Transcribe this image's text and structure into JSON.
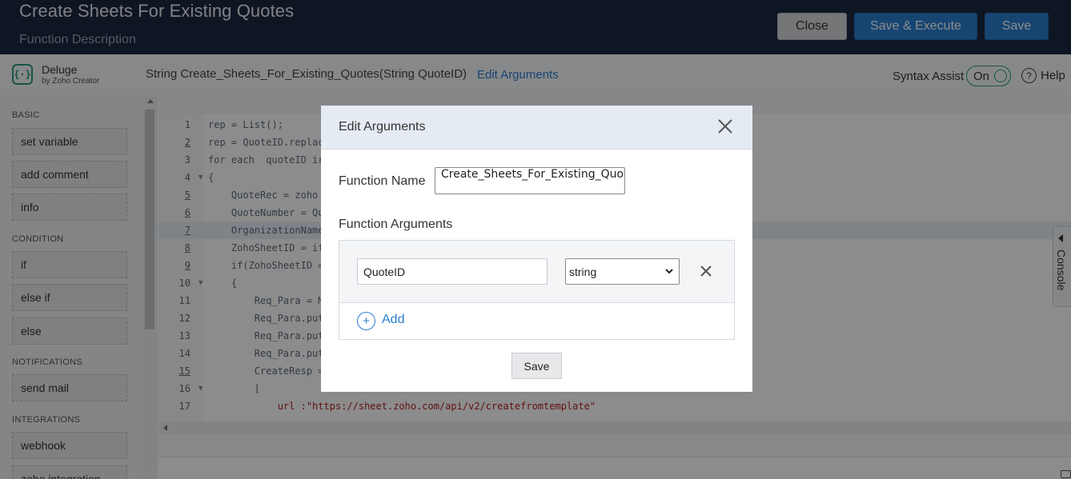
{
  "header": {
    "title": "Create Sheets For Existing Quotes",
    "description": "Function Description",
    "close_label": "Close",
    "save_execute_label": "Save & Execute",
    "save_label": "Save"
  },
  "toolbar": {
    "logo_glyph": "{·}",
    "product_name": "Deluge",
    "product_sub": "by Zoho Creator",
    "signature": "String  Create_Sheets_For_Existing_Quotes(String QuoteID)",
    "edit_arguments": "Edit Arguments",
    "syntax_assist_label": "Syntax Assist",
    "syntax_assist_state": "On",
    "help_glyph": "?",
    "help_label": "Help"
  },
  "sidebar": {
    "sections": [
      {
        "label": "BASIC",
        "items": [
          "set variable",
          "add comment",
          "info"
        ]
      },
      {
        "label": "CONDITION",
        "items": [
          "if",
          "else if",
          "else"
        ]
      },
      {
        "label": "NOTIFICATIONS",
        "items": [
          "send mail"
        ]
      },
      {
        "label": "INTEGRATIONS",
        "items": [
          "webhook",
          "zoho integration"
        ]
      }
    ]
  },
  "editor": {
    "lines": [
      {
        "n": "1",
        "text": "rep = List();"
      },
      {
        "n": "2",
        "text": "rep = QuoteID.replac"
      },
      {
        "n": "3",
        "text": "for each  quoteID ir"
      },
      {
        "n": "4",
        "text": "{"
      },
      {
        "n": "5",
        "text": "    QuoteRec = zoho"
      },
      {
        "n": "6",
        "text": "    QuoteNumber = Qu"
      },
      {
        "n": "7",
        "text": "    OrganizationName"
      },
      {
        "n": "8",
        "text": "    ZohoSheetID = if"
      },
      {
        "n": "9",
        "text": "    if(ZohoSheetID ="
      },
      {
        "n": "10",
        "text": "    {"
      },
      {
        "n": "11",
        "text": "        Req_Para = M"
      },
      {
        "n": "12",
        "text": "        Req_Para.put"
      },
      {
        "n": "13",
        "text": "        Req_Para.put"
      },
      {
        "n": "14",
        "text": "        Req_Para.put"
      },
      {
        "n": "15",
        "text": "        CreateResp ="
      },
      {
        "n": "16",
        "text": "        ["
      },
      {
        "n": "17",
        "text": "            url :\"https://sheet.zoho.com/api/v2/createfromtemplate\""
      }
    ],
    "console_label": "Console"
  },
  "modal": {
    "title": "Edit Arguments",
    "function_name_label": "Function Name",
    "function_name_value": "Create_Sheets_For_Existing_Quotes",
    "function_arguments_label": "Function Arguments",
    "argument_name": "QuoteID",
    "argument_type": "string",
    "add_glyph": "+",
    "add_label": "Add",
    "save_label": "Save"
  }
}
